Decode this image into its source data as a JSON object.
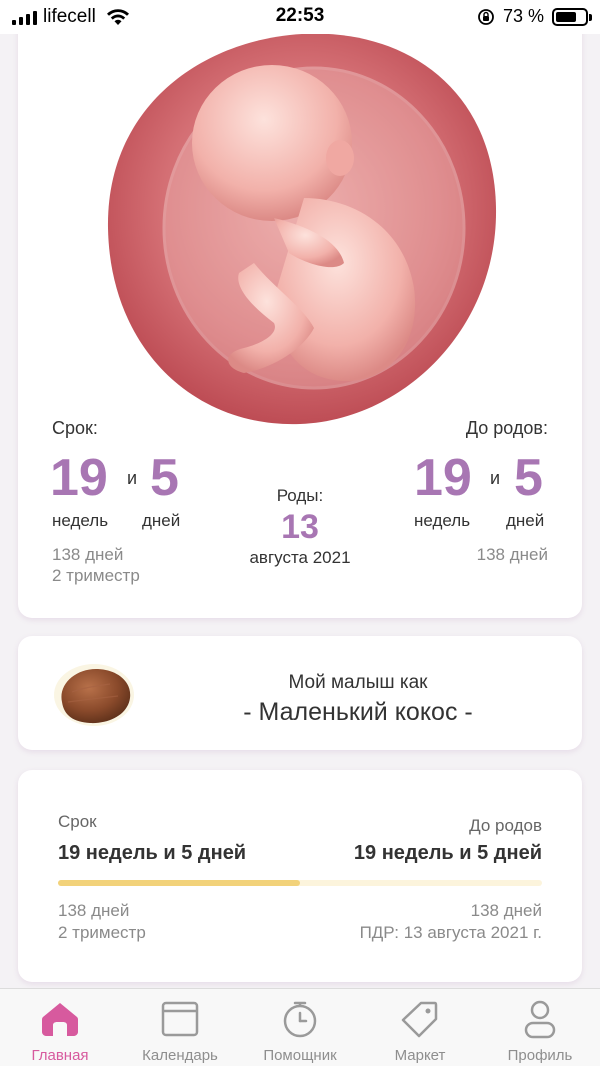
{
  "status_bar": {
    "carrier": "lifecell",
    "time": "22:53",
    "battery_percent": "73 %",
    "battery_level": 0.73
  },
  "hero": {
    "term_label": "Срок:",
    "until_label": "До родов:",
    "term": {
      "weeks": "19",
      "and": "и",
      "days": "5",
      "weeks_unit": "недель",
      "days_unit": "дней",
      "total_days": "138 дней",
      "trimester": "2 триместр"
    },
    "until": {
      "weeks": "19",
      "and": "и",
      "days": "5",
      "weeks_unit": "недель",
      "days_unit": "дней",
      "total_days": "138 дней"
    },
    "birth": {
      "label": "Роды:",
      "day": "13",
      "month_year": "августа 2021"
    }
  },
  "baby": {
    "line1": "Мой малыш как",
    "line2": "- Маленький кокос -"
  },
  "progress": {
    "term_label": "Срок",
    "until_label": "До родов",
    "term_value": "19 недель и 5 дней",
    "until_value": "19 недель и 5 дней",
    "fill_fraction": 0.5,
    "term_days": "138 дней",
    "term_trimester": "2 триместр",
    "until_days": "138 дней",
    "due_date": "ПДР: 13 августа 2021 г."
  },
  "tabs": [
    {
      "label": "Главная",
      "icon": "home-icon",
      "active": true
    },
    {
      "label": "Календарь",
      "icon": "calendar-icon",
      "active": false
    },
    {
      "label": "Помощник",
      "icon": "stopwatch-icon",
      "active": false
    },
    {
      "label": "Маркет",
      "icon": "tag-icon",
      "active": false
    },
    {
      "label": "Профиль",
      "icon": "profile-icon",
      "active": false
    }
  ],
  "colors": {
    "accent": "#a876b3",
    "tab_active": "#d75a9e",
    "progress_fill": "#f2d27a",
    "progress_track": "#fcf4dc"
  }
}
